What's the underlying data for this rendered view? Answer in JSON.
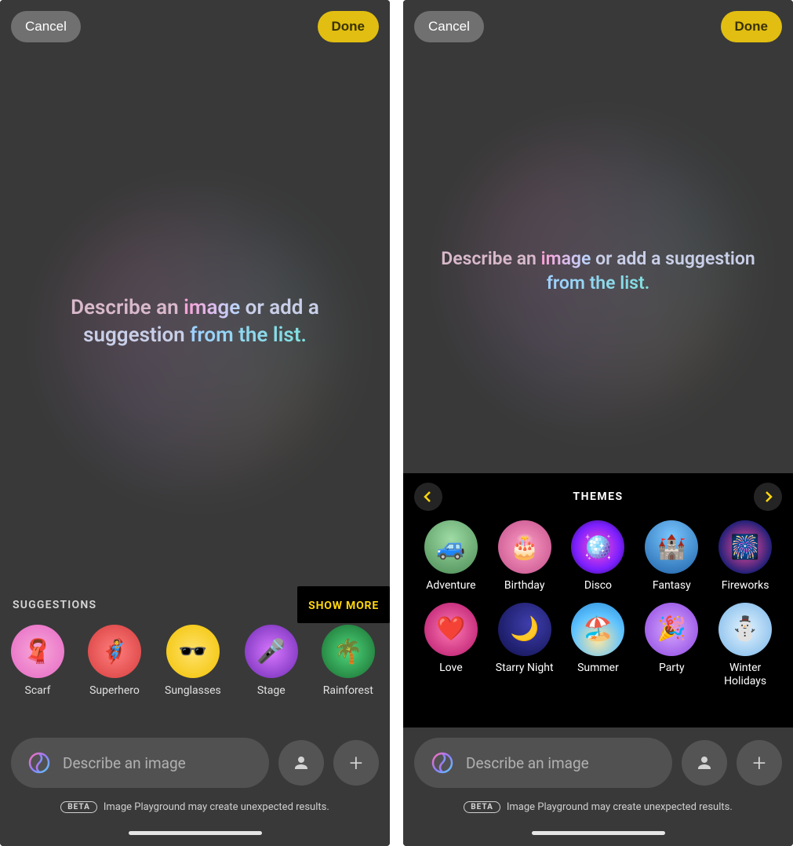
{
  "left": {
    "header": {
      "cancel": "Cancel",
      "done": "Done"
    },
    "hero": {
      "p1": "Describe an ",
      "p2": "image",
      "p3": " or add a suggestion ",
      "p4": "from the list."
    },
    "suggestions": {
      "title": "SUGGESTIONS",
      "show_more": "SHOW MORE",
      "items": [
        {
          "label": "Scarf",
          "icon": "🧣"
        },
        {
          "label": "Superhero",
          "icon": "🦸"
        },
        {
          "label": "Sunglasses",
          "icon": "🕶️"
        },
        {
          "label": "Stage",
          "icon": "🎤"
        },
        {
          "label": "Rainforest",
          "icon": "🌴"
        }
      ]
    },
    "input": {
      "placeholder": "Describe an image"
    },
    "beta": {
      "badge": "BETA",
      "text": "Image Playground may create unexpected results."
    }
  },
  "right": {
    "header": {
      "cancel": "Cancel",
      "done": "Done"
    },
    "hero": {
      "p1": "Describe an ",
      "p2": "image",
      "p3": " or add a suggestion ",
      "p4": "from the list."
    },
    "themes": {
      "title": "THEMES",
      "items": [
        {
          "label": "Adventure",
          "icon": "🚙"
        },
        {
          "label": "Birthday",
          "icon": "🎂"
        },
        {
          "label": "Disco",
          "icon": "🪩"
        },
        {
          "label": "Fantasy",
          "icon": "🏰"
        },
        {
          "label": "Fireworks",
          "icon": "🎆"
        },
        {
          "label": "Love",
          "icon": "❤️"
        },
        {
          "label": "Starry Night",
          "icon": "🌙"
        },
        {
          "label": "Summer",
          "icon": "🏖️"
        },
        {
          "label": "Party",
          "icon": "🎉"
        },
        {
          "label": "Winter Holidays",
          "icon": "⛄"
        }
      ]
    },
    "input": {
      "placeholder": "Describe an image"
    },
    "beta": {
      "badge": "BETA",
      "text": "Image Playground may create unexpected results."
    }
  },
  "colors": {
    "accent_yellow": "#ffd60a"
  }
}
